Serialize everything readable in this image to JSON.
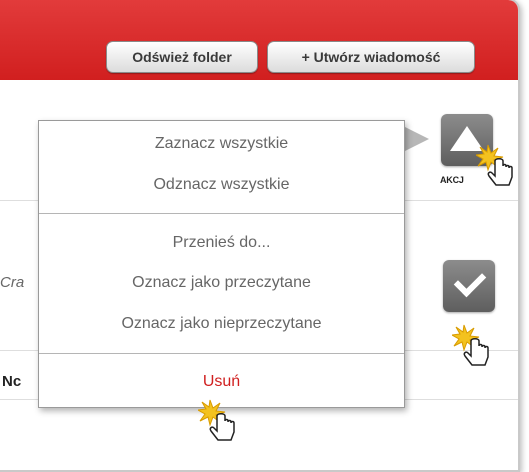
{
  "toolbar": {
    "refresh_label": "Odśwież folder",
    "compose_label": "+ Utwórz wiadomość"
  },
  "background": {
    "partial_text_1": "Cra",
    "partial_text_2": "Nc"
  },
  "actions": {
    "akcje_label": "AKCJ",
    "up_icon": "triangle-up-icon",
    "check_icon": "checkmark-icon"
  },
  "menu": {
    "items": [
      {
        "label": "Zaznacz wszystkie"
      },
      {
        "label": "Odznacz wszystkie"
      },
      {
        "label": "Przenieś do..."
      },
      {
        "label": "Oznacz jako przeczytane"
      },
      {
        "label": "Oznacz jako nieprzeczytane"
      },
      {
        "label": "Usuń"
      }
    ]
  },
  "colors": {
    "topbar": "#d11f1f",
    "delete_text": "#d01f1f"
  }
}
